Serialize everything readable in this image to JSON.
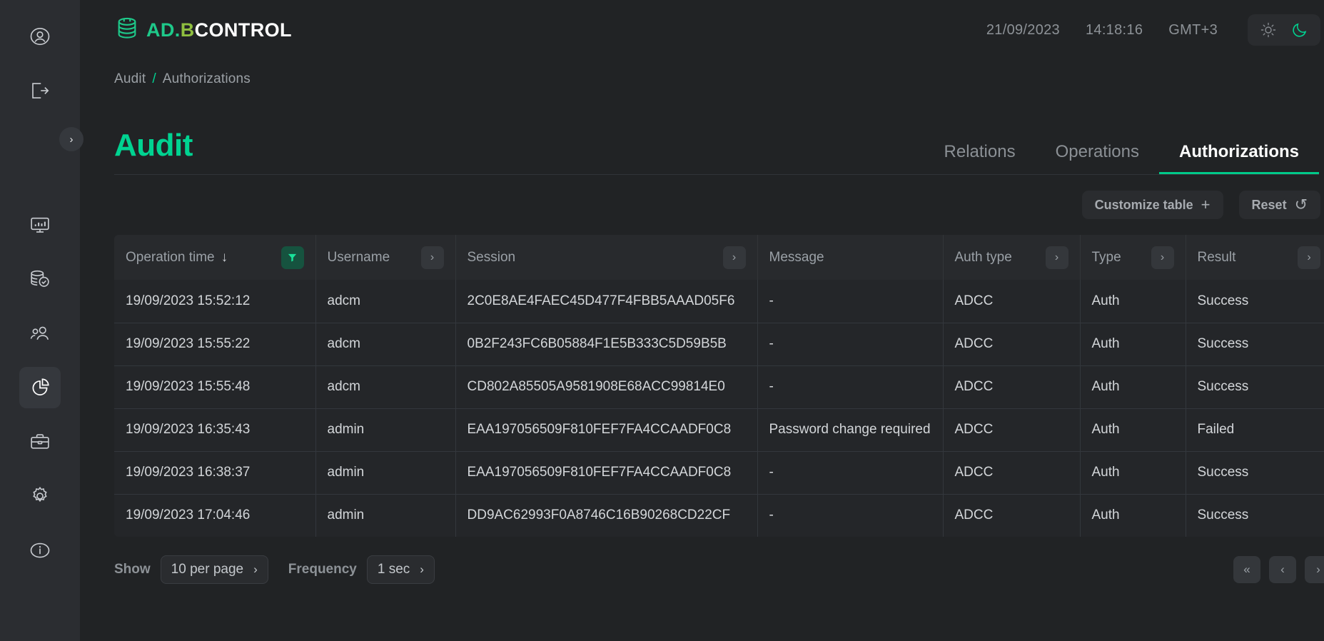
{
  "sidebar": {
    "top_items": [
      {
        "name": "profile-icon",
        "label": "Profile"
      },
      {
        "name": "logout-icon",
        "label": "Logout"
      }
    ],
    "nav_items": [
      {
        "name": "dashboard-icon",
        "label": "Dashboard",
        "active": false
      },
      {
        "name": "database-backup-icon",
        "label": "Backups",
        "active": false
      },
      {
        "name": "users-icon",
        "label": "Users",
        "active": false
      },
      {
        "name": "pie-chart-icon",
        "label": "Audit",
        "active": true
      },
      {
        "name": "briefcase-icon",
        "label": "Jobs",
        "active": false
      },
      {
        "name": "gear-icon",
        "label": "Settings",
        "active": false
      },
      {
        "name": "info-icon",
        "label": "About",
        "active": false
      }
    ],
    "expand_label": "›"
  },
  "header": {
    "logo": {
      "ad": "AD.",
      "b": "B",
      "control": "CONTROL"
    },
    "date": "21/09/2023",
    "time": "14:18:16",
    "timezone": "GMT+3",
    "theme": {
      "light_icon": "sun-icon",
      "dark_icon": "moon-icon",
      "active": "dark"
    }
  },
  "breadcrumb": {
    "root": "Audit",
    "separator": "/",
    "current": "Authorizations"
  },
  "page": {
    "title": "Audit",
    "tabs": [
      {
        "label": "Relations",
        "active": false
      },
      {
        "label": "Operations",
        "active": false
      },
      {
        "label": "Authorizations",
        "active": true
      }
    ]
  },
  "toolbar": {
    "customize_label": "Customize table",
    "customize_icon": "+",
    "reset_label": "Reset",
    "reset_icon": "↺"
  },
  "table": {
    "columns": [
      {
        "label": "Operation time",
        "sort": "desc",
        "control": "filter"
      },
      {
        "label": "Username",
        "control": "chevron"
      },
      {
        "label": "Session",
        "control": "chevron"
      },
      {
        "label": "Message",
        "control": "none"
      },
      {
        "label": "Auth type",
        "control": "chevron"
      },
      {
        "label": "Type",
        "control": "chevron"
      },
      {
        "label": "Result",
        "control": "chevron"
      }
    ],
    "rows": [
      {
        "time": "19/09/2023 15:52:12",
        "username": "adcm",
        "session": "2C0E8AE4FAEC45D477F4FBB5AAAD05F6",
        "message": "-",
        "auth_type": "ADCC",
        "type": "Auth",
        "result": "Success"
      },
      {
        "time": "19/09/2023 15:55:22",
        "username": "adcm",
        "session": "0B2F243FC6B05884F1E5B333C5D59B5B",
        "message": "-",
        "auth_type": "ADCC",
        "type": "Auth",
        "result": "Success"
      },
      {
        "time": "19/09/2023 15:55:48",
        "username": "adcm",
        "session": "CD802A85505A9581908E68ACC99814E0",
        "message": "-",
        "auth_type": "ADCC",
        "type": "Auth",
        "result": "Success"
      },
      {
        "time": "19/09/2023 16:35:43",
        "username": "admin",
        "session": "EAA197056509F810FEF7FA4CCAADF0C8",
        "message": "Password change required",
        "auth_type": "ADCC",
        "type": "Auth",
        "result": "Failed"
      },
      {
        "time": "19/09/2023 16:38:37",
        "username": "admin",
        "session": "EAA197056509F810FEF7FA4CCAADF0C8",
        "message": "-",
        "auth_type": "ADCC",
        "type": "Auth",
        "result": "Success"
      },
      {
        "time": "19/09/2023 17:04:46",
        "username": "admin",
        "session": "DD9AC62993F0A8746C16B90268CD22CF",
        "message": "-",
        "auth_type": "ADCC",
        "type": "Auth",
        "result": "Success"
      }
    ]
  },
  "footer": {
    "show_label": "Show",
    "per_page_value": "10 per page",
    "frequency_label": "Frequency",
    "frequency_value": "1 sec",
    "chevron": "›",
    "pagination": {
      "first": "«",
      "prev": "‹",
      "next": "›"
    }
  },
  "colors": {
    "accent_green": "#00d391",
    "logo_olive": "#8fbf3f",
    "background": "#212325",
    "sidebar_bg": "#2b2d31",
    "table_header_bg": "#282a2d",
    "table_row_bg": "#242629"
  }
}
